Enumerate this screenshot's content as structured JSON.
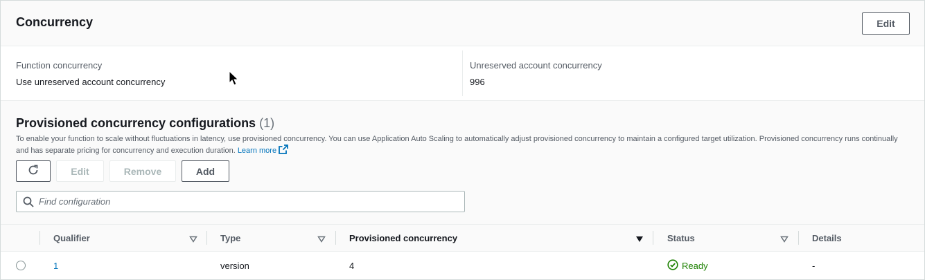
{
  "header": {
    "title": "Concurrency",
    "edit_label": "Edit"
  },
  "concurrency": {
    "function_label": "Function concurrency",
    "function_value": "Use unreserved account concurrency",
    "unreserved_label": "Unreserved account concurrency",
    "unreserved_value": "996"
  },
  "provisioned": {
    "title": "Provisioned concurrency configurations",
    "count": "(1)",
    "description": "To enable your function to scale without fluctuations in latency, use provisioned concurrency. You can use Application Auto Scaling to automatically adjust provisioned concurrency to maintain a configured target utilization. Provisioned concurrency runs continually and has separate pricing for concurrency and execution duration.",
    "learn_more": "Learn more",
    "buttons": {
      "refresh_icon": "refresh-icon",
      "edit": "Edit",
      "remove": "Remove",
      "add": "Add"
    },
    "search": {
      "placeholder": "Find configuration",
      "value": ""
    }
  },
  "table": {
    "columns": [
      "Qualifier",
      "Type",
      "Provisioned concurrency",
      "Status",
      "Details"
    ],
    "sorted_column": "Provisioned concurrency",
    "rows": [
      {
        "qualifier": "1",
        "type": "version",
        "provisioned_concurrency": "4",
        "status": "Ready",
        "details": "-"
      }
    ]
  },
  "colors": {
    "link": "#0073bb",
    "status_ready": "#1d8102",
    "border": "#eaeded"
  }
}
